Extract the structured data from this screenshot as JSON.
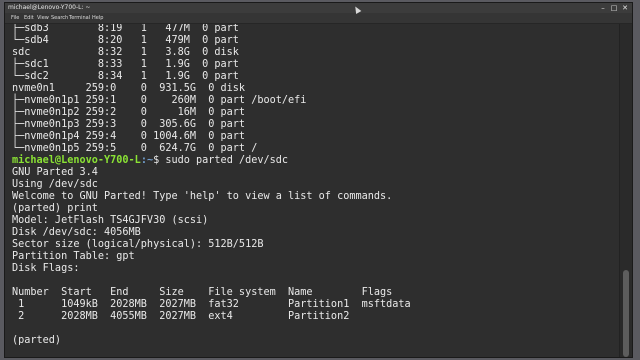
{
  "window": {
    "title": "michael@Lenovo-Y700-L: ~",
    "controls": {
      "minimize": "–",
      "maximize": "□",
      "close": "✕"
    }
  },
  "menubar": {
    "items": [
      "File",
      "Edit",
      "View",
      "Search",
      "Terminal",
      "Help"
    ]
  },
  "terminal": {
    "lines": [
      "├─sdb3        8:19   1   477M  0 part",
      "└─sdb4        8:20   1   479M  0 part",
      "sdc           8:32   1   3.8G  0 disk",
      "├─sdc1        8:33   1   1.9G  0 part",
      "└─sdc2        8:34   1   1.9G  0 part",
      "nvme0n1     259:0    0  931.5G  0 disk",
      "├─nvme0n1p1 259:1    0    260M  0 part /boot/efi",
      "├─nvme0n1p2 259:2    0     16M  0 part",
      "├─nvme0n1p3 259:3    0  305.6G  0 part",
      "├─nvme0n1p4 259:4    0 1004.6M  0 part",
      "└─nvme0n1p5 259:5    0  624.7G  0 part /",
      "",
      "GNU Parted 3.4",
      "Using /dev/sdc",
      "Welcome to GNU Parted! Type 'help' to view a list of commands.",
      "(parted) print",
      "Model: JetFlash TS4GJFV30 (scsi)",
      "Disk /dev/sdc: 4056MB",
      "Sector size (logical/physical): 512B/512B",
      "Partition Table: gpt",
      "Disk Flags:",
      "",
      "Number  Start   End     Size    File system  Name        Flags",
      " 1      1049kB  2028MB  2027MB  fat32        Partition1  msftdata",
      " 2      2028MB  4055MB  2027MB  ext4         Partition2",
      "",
      "(parted)"
    ],
    "prompt": {
      "user_host": "michael@Lenovo-Y700-L",
      "path": ":~",
      "tail": "$ sudo parted /dev/sdc"
    },
    "prompt_line_index": 11
  },
  "scrollbar": {
    "thumb_fraction_start": 0.74,
    "thumb_fraction_size": 0.26
  },
  "colors": {
    "background": "#2e2e2e",
    "text": "#e9e9e9",
    "prompt_user": "#8ae234",
    "prompt_path": "#729fcf"
  }
}
